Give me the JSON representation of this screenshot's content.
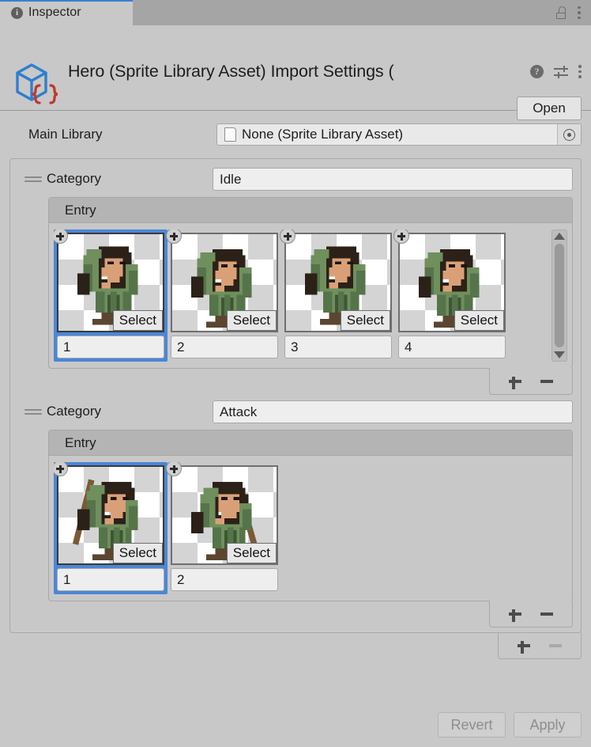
{
  "window": {
    "tab": {
      "label": "Inspector",
      "icon": "info-icon"
    },
    "lock_icon": "unlock-icon",
    "menu_icon": "kebab-menu-icon"
  },
  "header": {
    "asset_icon": "scriptable-object-icon",
    "title": "Hero (Sprite Library Asset) Import Settings (",
    "help_icon": "help-icon",
    "preset_icon": "preset-settings-icon",
    "menu_icon": "kebab-menu-icon",
    "open_label": "Open"
  },
  "main_library": {
    "label": "Main Library",
    "value": "None (Sprite Library Asset)",
    "doc_icon": "document-icon",
    "picker_icon": "object-picker-icon"
  },
  "categories": [
    {
      "label": "Category",
      "name": "Idle",
      "entry_label": "Entry",
      "entries": [
        {
          "index": "1",
          "select_label": "Select",
          "selected": true
        },
        {
          "index": "2",
          "select_label": "Select",
          "selected": false
        },
        {
          "index": "3",
          "select_label": "Select",
          "selected": false
        },
        {
          "index": "4",
          "select_label": "Select",
          "selected": false
        }
      ],
      "scrollbar": true,
      "add_label": "+",
      "remove_label": "-",
      "remove_disabled": false
    },
    {
      "label": "Category",
      "name": "Attack",
      "entry_label": "Entry",
      "entries": [
        {
          "index": "1",
          "select_label": "Select",
          "selected": true
        },
        {
          "index": "2",
          "select_label": "Select",
          "selected": false
        }
      ],
      "scrollbar": false,
      "add_label": "+",
      "remove_label": "-",
      "remove_disabled": false
    }
  ],
  "category_list_controls": {
    "add_label": "+",
    "remove_label": "-",
    "remove_disabled": true
  },
  "footer": {
    "revert_label": "Revert",
    "apply_label": "Apply",
    "disabled": true
  },
  "colors": {
    "panel_bg": "#c8c8c8",
    "tabbar_bg": "#a5a5a5",
    "accent_blue": "#3b7fd4",
    "selection_blue": "#4a87d8",
    "field_bg": "#eeeeee",
    "entry_header_bg": "#b4b4b4",
    "disabled_text": "#8e8e8e"
  }
}
